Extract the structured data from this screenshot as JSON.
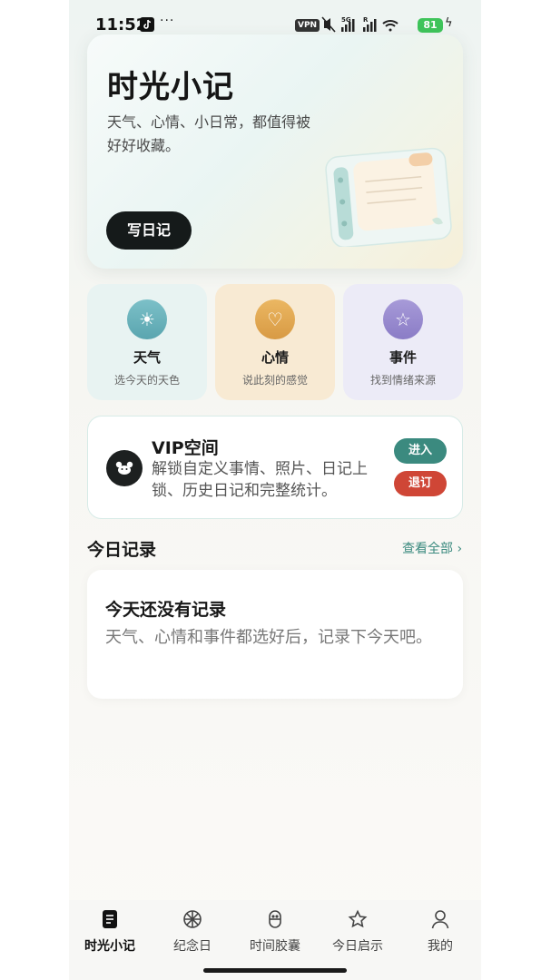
{
  "status_bar": {
    "time": "11:52",
    "more": "···",
    "vpn": "VPN",
    "battery": "81",
    "icons": [
      "tiktok-icon",
      "mute-icon",
      "signal-5g-icon",
      "signal-icon",
      "wifi-icon",
      "charging-icon"
    ]
  },
  "hero": {
    "title": "时光小记",
    "subtitle": "天气、心情、小日常，都值得被好好收藏。",
    "button": "写日记"
  },
  "quick_cards": [
    {
      "title": "天气",
      "subtitle": "选今天的天色",
      "icon": "sun-icon"
    },
    {
      "title": "心情",
      "subtitle": "说此刻的感觉",
      "icon": "heart-icon"
    },
    {
      "title": "事件",
      "subtitle": "找到情绪来源",
      "icon": "star-icon"
    }
  ],
  "vip": {
    "title": "VIP空间",
    "description": "解锁自定义事情、照片、日记上锁、历史日记和完整统计。",
    "enter": "进入",
    "unsubscribe": "退订"
  },
  "today": {
    "title": "今日记录",
    "see_all": "查看全部 ›",
    "empty_title": "今天还没有记录",
    "empty_desc": "天气、心情和事件都选好后，记录下今天吧。"
  },
  "nav": [
    {
      "label": "时光小记",
      "icon": "diary-icon",
      "active": true
    },
    {
      "label": "纪念日",
      "icon": "anniversary-icon",
      "active": false
    },
    {
      "label": "时间胶囊",
      "icon": "capsule-icon",
      "active": false
    },
    {
      "label": "今日启示",
      "icon": "star-icon",
      "active": false
    },
    {
      "label": "我的",
      "icon": "profile-icon",
      "active": false
    }
  ],
  "colors": {
    "accent": "#3b8a7f",
    "danger": "#cf4636",
    "weather": "#5aa5af",
    "mood": "#d89a44",
    "event": "#8a7cc6"
  }
}
